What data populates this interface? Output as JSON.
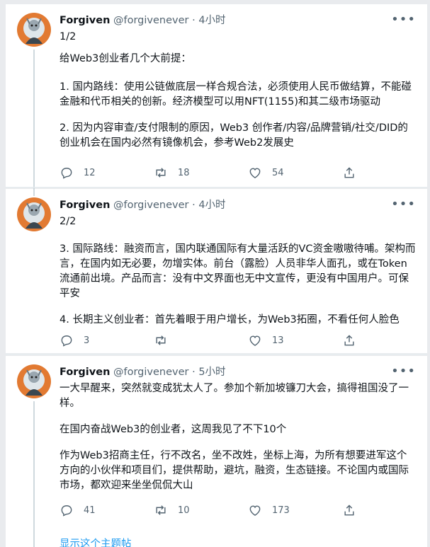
{
  "tweets": [
    {
      "name": "Forgiven",
      "handle": "@forgivenever",
      "time": "4小时",
      "paragraphs": [
        "1/2",
        "给Web3创业者几个大前提：",
        "1. 国内路线：使用公链做底层一样合规合法，必须使用人民币做结算，不能碰金融和代币相关的创新。经济模型可以用NFT(1155)和其二级市场驱动",
        "2. 因为内容审查/支付限制的原因，Web3 创作者/内容/品牌营销/社交/DID的创业机会在国内必然有镜像机会，参考Web2发展史"
      ],
      "replies": "12",
      "retweets": "18",
      "likes": "54"
    },
    {
      "name": "Forgiven",
      "handle": "@forgivenever",
      "time": "4小时",
      "paragraphs": [
        "2/2",
        "3. 国际路线：融资而言，国内联通国际有大量活跃的VC资金嗷嗷待哺。架构而言，在国内如无必要，勿增实体。前台（露脸）人员非华人面孔，或在Token流通前出境。产品而言：没有中文界面也无中文宣传，更没有中国用户。可保平安",
        "4. 长期主义创业者：首先着眼于用户增长，为Web3拓圈，不看任何人脸色"
      ],
      "replies": "3",
      "retweets": "",
      "likes": "13"
    },
    {
      "name": "Forgiven",
      "handle": "@forgivenever",
      "time": "5小时",
      "paragraphs": [
        "一大早醒来，突然就变成犹太人了。参加个新加坡镰刀大会，搞得祖国没了一样。",
        "在国内奋战Web3的创业者，这周我见了不下10个",
        "作为Web3招商主任，行不改名，坐不改姓，坐标上海，为所有想要进军这个方向的小伙伴和项目们，提供帮助，避坑，融资，生态链接。不论国内或国际市场，都欢迎来坐坐侃侃大山"
      ],
      "replies": "41",
      "retweets": "10",
      "likes": "173",
      "show_thread": "显示这个主题帖"
    }
  ],
  "colors": {
    "accent": "#1d9bf0",
    "muted": "#536471",
    "text": "#0f1419",
    "thread_line": "#cfd9de",
    "avatar_bg": "#e27a32"
  },
  "icons": [
    "reply-icon",
    "retweet-icon",
    "like-icon",
    "share-icon",
    "more-icon"
  ]
}
